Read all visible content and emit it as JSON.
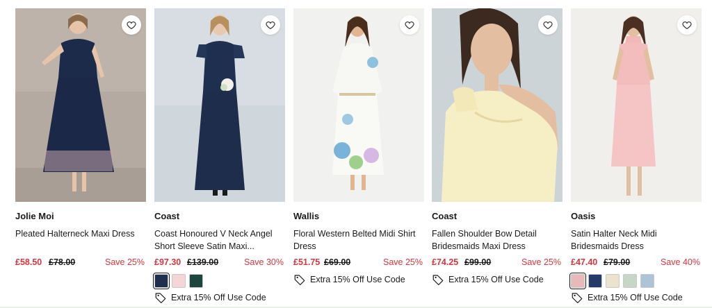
{
  "products": [
    {
      "brand": "Jolie Moi",
      "title": "Pleated Halterneck Maxi Dress",
      "price_now": "£58.50",
      "price_was": "£78.00",
      "save": "Save 25%",
      "swatches": [],
      "promo": ""
    },
    {
      "brand": "Coast",
      "title": "Coast Honoured V Neck Angel Short Sleeve Satin Maxi...",
      "price_now": "£97.30",
      "price_was": "£139.00",
      "save": "Save 30%",
      "swatches": [
        "#1f2f4f",
        "#f4d5d8",
        "#1d463e"
      ],
      "promo": "Extra 15% Off Use Code"
    },
    {
      "brand": "Wallis",
      "title": "Floral Western Belted Midi Shirt Dress",
      "price_now": "£51.75",
      "price_was": "£69.00",
      "save": "Save 25%",
      "swatches": [],
      "promo": "Extra 15% Off Use Code"
    },
    {
      "brand": "Coast",
      "title": "Fallen Shoulder Bow Detail Bridesmaids Maxi Dress",
      "price_now": "£74.25",
      "price_was": "£99.00",
      "save": "Save 25%",
      "swatches": [],
      "promo": "Extra 15% Off Use Code"
    },
    {
      "brand": "Oasis",
      "title": "Satin Halter Neck Midi Bridesmaids Dress",
      "price_now": "£47.40",
      "price_was": "£79.00",
      "save": "Save 40%",
      "swatches": [
        "#e8b9b9",
        "#243a6b",
        "#ece3cf",
        "#c7d6c6",
        "#aec4d6"
      ],
      "promo": "Extra 15% Off Use Code"
    }
  ],
  "icons": {
    "wishlist": "heart-icon",
    "promo": "tag-icon"
  },
  "colors": {
    "sale": "#d6363f",
    "text": "#1a1a1a"
  }
}
